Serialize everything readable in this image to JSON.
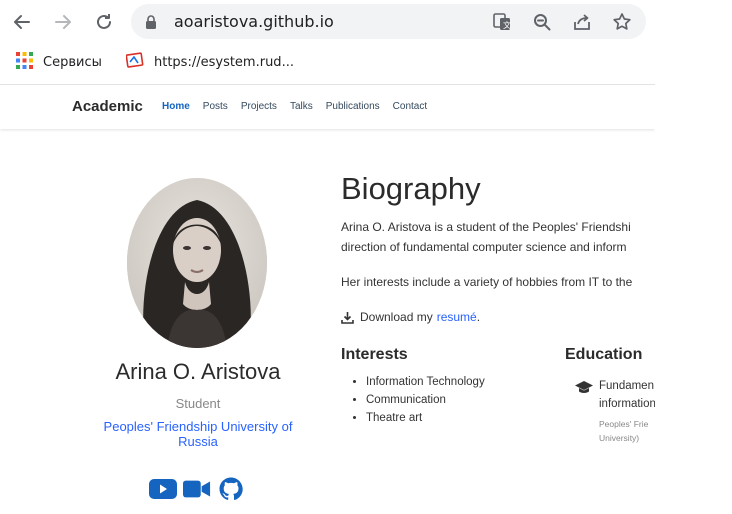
{
  "browser": {
    "url": "aoaristova.github.io",
    "bookmarks": [
      {
        "label": "Сервисы",
        "icon": "apps-grid-icon"
      },
      {
        "label": "https://esystem.rud...",
        "icon": "site-favicon-icon"
      }
    ]
  },
  "site": {
    "brand": "Academic",
    "menu": [
      "Home",
      "Posts",
      "Projects",
      "Talks",
      "Publications",
      "Contact"
    ],
    "active_menu": "Home"
  },
  "profile": {
    "name": "Arina O. Aristova",
    "role": "Student",
    "organization": "Peoples' Friendship University of Russia",
    "social_icons": [
      "youtube-icon",
      "video-camera-icon",
      "github-icon"
    ]
  },
  "biography": {
    "title": "Biography",
    "line1": "Arina O. Aristova is a student of the Peoples' Friendshi",
    "line2": "direction of fundamental computer science and inform",
    "line3": "Her interests include a variety of hobbies from IT to the",
    "download_prefix": "Download my",
    "download_link": "resumé",
    "download_suffix": "."
  },
  "interests": {
    "title": "Interests",
    "items": [
      "Information Technology",
      "Communication",
      "Theatre art"
    ]
  },
  "education": {
    "title": "Education",
    "course_line1": "Fundamen",
    "course_line2": "information",
    "institution_line1": "Peoples' Frie",
    "institution_line2": "University)"
  },
  "colors": {
    "accent_link": "#2962ff",
    "active_menu": "#1565c0",
    "social_blue": "#1565c0"
  }
}
